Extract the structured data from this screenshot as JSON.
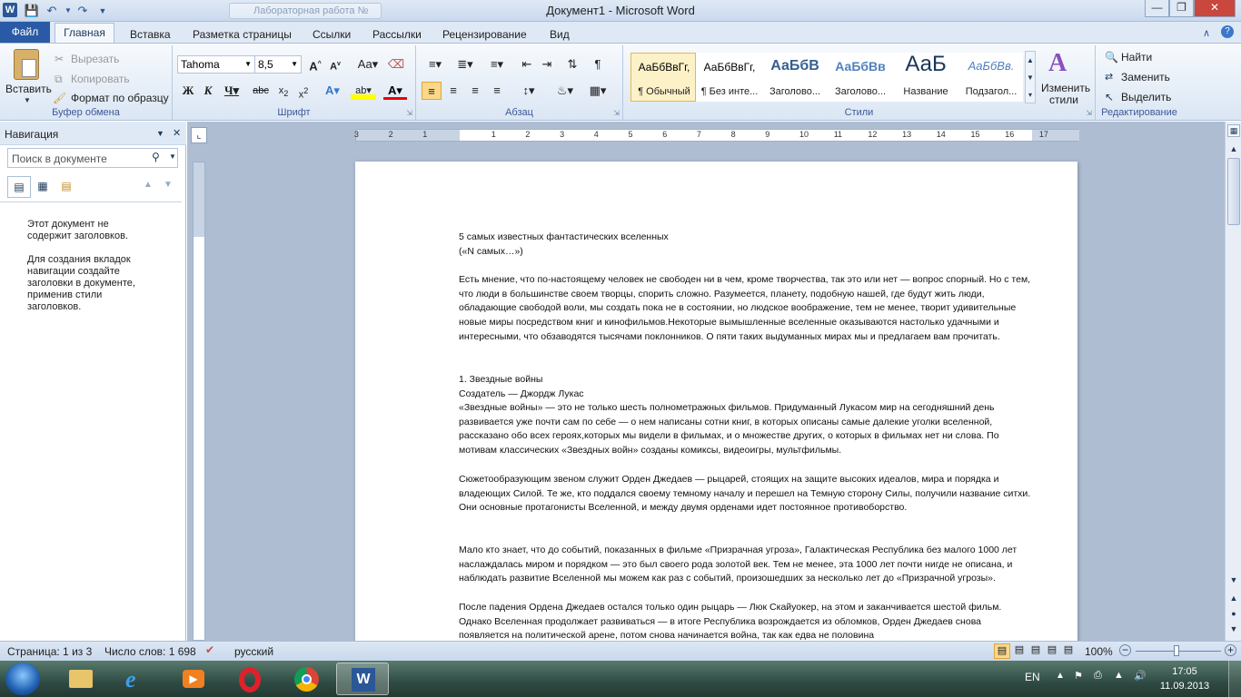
{
  "window": {
    "title": "Документ1 - Microsoft Word",
    "background_tab": "Лабораторная работа №"
  },
  "tabs": {
    "file": "Файл",
    "home": "Главная",
    "insert": "Вставка",
    "layout": "Разметка страницы",
    "refs": "Ссылки",
    "mail": "Рассылки",
    "review": "Рецензирование",
    "view": "Вид"
  },
  "clipboard": {
    "paste": "Вставить",
    "cut": "Вырезать",
    "copy": "Копировать",
    "format": "Формат по образцу",
    "label": "Буфер обмена"
  },
  "font": {
    "name": "Tahoma",
    "size": "8,5",
    "label": "Шрифт"
  },
  "paragraph": {
    "label": "Абзац"
  },
  "styles": {
    "label": "Стили",
    "change": "Изменить",
    "change2": "стили",
    "items": [
      {
        "preview": "АаБбВвГг,",
        "name": "¶ Обычный"
      },
      {
        "preview": "АаБбВвГг,",
        "name": "¶ Без инте..."
      },
      {
        "preview": "АаБбВ",
        "name": "Заголово..."
      },
      {
        "preview": "АаБбВв",
        "name": "Заголово..."
      },
      {
        "preview": "АаБ",
        "name": "Название"
      },
      {
        "preview": "АаБбВв.",
        "name": "Подзагол..."
      }
    ]
  },
  "editing": {
    "find": "Найти",
    "replace": "Заменить",
    "select": "Выделить",
    "label": "Редактирование"
  },
  "nav": {
    "title": "Навигация",
    "search_placeholder": "Поиск в документе",
    "msg1": "Этот документ не содержит заголовков.",
    "msg2": "Для создания вкладок навигации создайте заголовки в документе, применив стили заголовков."
  },
  "ruler": {
    "labels": [
      "3",
      "2",
      "1",
      "1",
      "2",
      "3",
      "4",
      "5",
      "6",
      "7",
      "8",
      "9",
      "10",
      "11",
      "12",
      "13",
      "14",
      "15",
      "16",
      "17"
    ]
  },
  "doc": {
    "l1": "5 самых известных  фантастических  вселенных",
    "l2": "(«N самых…»)",
    "p1": "Есть мнение, что по-настоящему человек не свободен ни в чем, кроме творчества, так это или нет — вопрос спорный. Но с тем, что люди  в большинстве своем творцы, спорить сложно. Разумеется, планету,  подобную нашей, где будут жить люди,  обладающие свободой воли, мы создать пока не в состоянии, но людское воображение, тем не менее, творит удивительные  новые миры посредством книг и кинофильмов.Некоторые вымышленные вселенные оказываются настолько удачными и интересными,  что обзаводятся тысячами поклонников. О пяти таких выдуманных мирах мы и предлагаем вам прочитать.",
    "h1": "1. Звездные войны",
    "h2": "Создатель — Джордж Лукас",
    "p2": "«Звездные  войны» — это не только шесть полнометражных фильмов. Придуманный Лукасом мир на сегодняшний день развивается уже почти сам по себе — о нем написаны сотни книг, в которых описаны самые далекие уголки вселенной,  рассказано обо всех героях,которых мы видели в фильмах,  и о множестве других, о которых в фильмах нет ни слова. По мотивам классических «Звездных  войн» созданы комиксы, видеоигры, мультфильмы.",
    "p3": "Сюжетообразующим звеном служит Орден Джедаев — рыцарей, стоящих на защите высоких идеалов, мира и порядка и владеющих  Силой. Те же, кто поддался своему темному началу и перешел на Темную сторону Силы, получили название  ситхи.  Они основные протагонисты Вселенной, и между двумя орденами идет постоянное противоборство.",
    "p4": "Мало кто знает, что до событий,  показанных в фильме  «Призрачная угроза», Галактическая Республика  без малого 1000 лет наслаждалась  миром и порядком — это был своего рода золотой век. Тем не менее, эта 1000 лет почти нигде не описана, и наблюдать  развитие Вселенной мы можем как раз с событий, произошедших за несколько лет до «Призрачной угрозы».",
    "p5": "После падения  Ордена Джедаев остался только один рыцарь — Люк  Скайуокер, на этом и заканчивается  шестой фильм.  Однако Вселенная  продолжает развиваться — в итоге Республика  возрождается из обломков, Орден Джедаев снова появляется на политической арене, потом снова начинается  война, так как едва не половина"
  },
  "status": {
    "page": "Страница: 1 из 3",
    "words": "Число слов: 1 698",
    "lang": "русский",
    "zoom": "100%"
  },
  "tray": {
    "lang": "EN",
    "time": "17:05",
    "date": "11.09.2013"
  }
}
